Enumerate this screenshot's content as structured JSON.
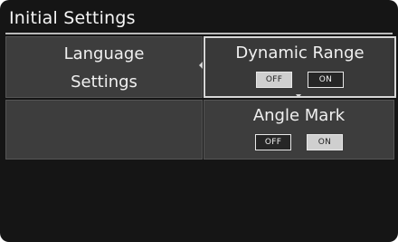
{
  "header": {
    "title": "Initial Settings"
  },
  "menu": {
    "language": {
      "line1": "Language",
      "line2": "Settings"
    },
    "dynamic_range": {
      "label": "Dynamic Range",
      "off_label": "OFF",
      "on_label": "ON",
      "selected": "OFF"
    },
    "angle_mark": {
      "label": "Angle Mark",
      "off_label": "OFF",
      "on_label": "ON",
      "selected": "ON"
    }
  },
  "colors": {
    "background": "#151515",
    "panel": "#3d3d3d",
    "highlight_border": "#d6d6d6",
    "selected_option": "#cfcfcf"
  }
}
